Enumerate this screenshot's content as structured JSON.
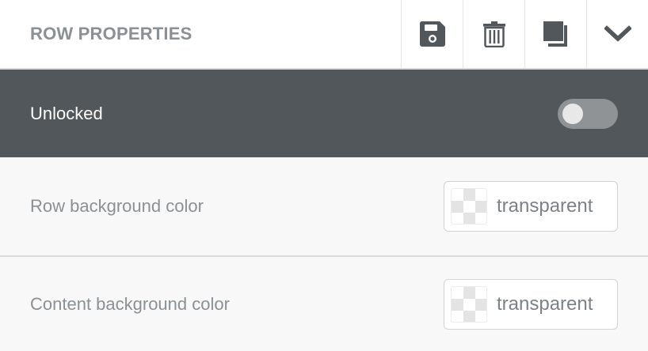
{
  "header": {
    "title": "ROW PROPERTIES",
    "tools": [
      {
        "icon": "save-icon"
      },
      {
        "icon": "trash-icon"
      },
      {
        "icon": "duplicate-icon"
      },
      {
        "icon": "chevron-down-icon"
      }
    ]
  },
  "lock": {
    "label": "Unlocked",
    "enabled": false
  },
  "properties": [
    {
      "label": "Row background color",
      "value": "transparent"
    },
    {
      "label": "Content background color",
      "value": "transparent"
    }
  ],
  "colors": {
    "header_bg": "#ffffff",
    "title": "#8a9093",
    "lock_row_bg": "#51575b",
    "icon": "#51575b",
    "toggle_track": "#8f9396",
    "toggle_knob": "#e8e8e8",
    "panel_bg": "#f8f8f8"
  }
}
